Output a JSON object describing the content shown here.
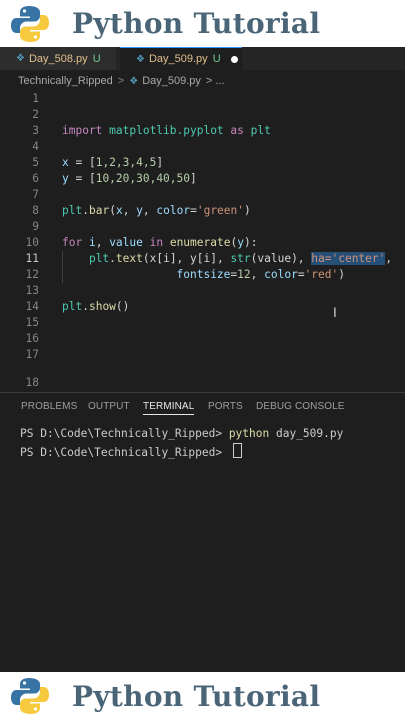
{
  "banner": {
    "title": "Python Tutorial"
  },
  "tabs": [
    {
      "label": "Day_508.py",
      "status": "U",
      "icon": "python-file-icon"
    },
    {
      "label": "Day_509.py",
      "status": "U",
      "icon": "python-file-icon",
      "modified": true
    }
  ],
  "breadcrumb": {
    "folder": "Technically_Ripped",
    "sep": ">",
    "file": "Day_509.py",
    "more": "> ..."
  },
  "editor": {
    "line_numbers": [
      "1",
      "2",
      "3",
      "4",
      "5",
      "6",
      "7",
      "8",
      "9",
      "10",
      "11",
      "12",
      "13",
      "14",
      "15",
      "16",
      "17",
      "18"
    ],
    "active_line": "11"
  },
  "panel": {
    "tabs": [
      "PROBLEMS",
      "OUTPUT",
      "TERMINAL",
      "PORTS",
      "DEBUG CONSOLE"
    ],
    "active_tab": "TERMINAL",
    "lines": [
      {
        "prompt": "PS D:\\Code\\Technically_Ripped> ",
        "cmd": "python",
        "args": " day_509.py"
      },
      {
        "prompt": "PS D:\\Code\\Technically_Ripped> ",
        "cmd": "",
        "args": ""
      }
    ]
  },
  "code": {
    "l3": {
      "kw1": "import",
      "mod": " matplotlib.pyplot ",
      "kw2": "as",
      "alias": " plt"
    },
    "l5": {
      "var": "x",
      "eq": " = [",
      "vals": "1,2,3,4,5",
      "end": "]"
    },
    "l6": {
      "var": "y",
      "eq": " = [",
      "vals": "10,20,30,40,50",
      "end": "]"
    },
    "l8": {
      "obj": "plt",
      "dot": ".",
      "fn": "bar",
      "open": "(",
      "a1": "x",
      "c1": ", ",
      "a2": "y",
      "c2": ", ",
      "kw": "color",
      "eq": "=",
      "str": "'green'",
      "close": ")"
    },
    "l10": {
      "kw1": "for",
      "v1": " i",
      "c": ",",
      "v2": " value",
      "kw2": " in",
      "fn": " enumerate",
      "open": "(",
      "arg": "y",
      "close": "):"
    },
    "l11": {
      "indent": "    ",
      "obj": "plt",
      "dot": ".",
      "fn": "text",
      "p1": "(x[i], y[i], ",
      "fn2": "str",
      "p2": "(value), ",
      "sel": "ha='center'",
      "end": ","
    },
    "l12": {
      "indent": "                 ",
      "kw1": "fontsize",
      "eq1": "=",
      "num": "12",
      "c": ", ",
      "kw2": "color",
      "eq2": "=",
      "str": "'red'",
      "close": ")"
    },
    "l14": {
      "obj": "plt",
      "dot": ".",
      "fn": "show",
      "close": "()"
    }
  }
}
